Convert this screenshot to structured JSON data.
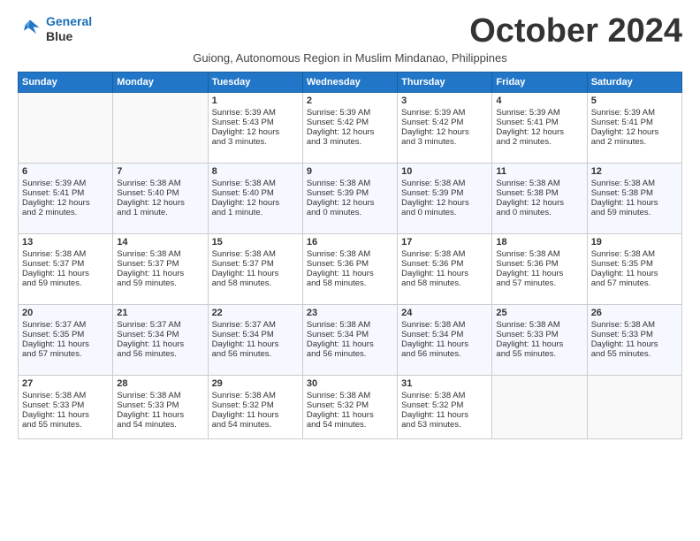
{
  "logo": {
    "line1": "General",
    "line2": "Blue"
  },
  "title": "October 2024",
  "subtitle": "Guiong, Autonomous Region in Muslim Mindanao, Philippines",
  "headers": [
    "Sunday",
    "Monday",
    "Tuesday",
    "Wednesday",
    "Thursday",
    "Friday",
    "Saturday"
  ],
  "weeks": [
    [
      {
        "day": "",
        "lines": []
      },
      {
        "day": "",
        "lines": []
      },
      {
        "day": "1",
        "lines": [
          "Sunrise: 5:39 AM",
          "Sunset: 5:43 PM",
          "Daylight: 12 hours",
          "and 3 minutes."
        ]
      },
      {
        "day": "2",
        "lines": [
          "Sunrise: 5:39 AM",
          "Sunset: 5:42 PM",
          "Daylight: 12 hours",
          "and 3 minutes."
        ]
      },
      {
        "day": "3",
        "lines": [
          "Sunrise: 5:39 AM",
          "Sunset: 5:42 PM",
          "Daylight: 12 hours",
          "and 3 minutes."
        ]
      },
      {
        "day": "4",
        "lines": [
          "Sunrise: 5:39 AM",
          "Sunset: 5:41 PM",
          "Daylight: 12 hours",
          "and 2 minutes."
        ]
      },
      {
        "day": "5",
        "lines": [
          "Sunrise: 5:39 AM",
          "Sunset: 5:41 PM",
          "Daylight: 12 hours",
          "and 2 minutes."
        ]
      }
    ],
    [
      {
        "day": "6",
        "lines": [
          "Sunrise: 5:39 AM",
          "Sunset: 5:41 PM",
          "Daylight: 12 hours",
          "and 2 minutes."
        ]
      },
      {
        "day": "7",
        "lines": [
          "Sunrise: 5:38 AM",
          "Sunset: 5:40 PM",
          "Daylight: 12 hours",
          "and 1 minute."
        ]
      },
      {
        "day": "8",
        "lines": [
          "Sunrise: 5:38 AM",
          "Sunset: 5:40 PM",
          "Daylight: 12 hours",
          "and 1 minute."
        ]
      },
      {
        "day": "9",
        "lines": [
          "Sunrise: 5:38 AM",
          "Sunset: 5:39 PM",
          "Daylight: 12 hours",
          "and 0 minutes."
        ]
      },
      {
        "day": "10",
        "lines": [
          "Sunrise: 5:38 AM",
          "Sunset: 5:39 PM",
          "Daylight: 12 hours",
          "and 0 minutes."
        ]
      },
      {
        "day": "11",
        "lines": [
          "Sunrise: 5:38 AM",
          "Sunset: 5:38 PM",
          "Daylight: 12 hours",
          "and 0 minutes."
        ]
      },
      {
        "day": "12",
        "lines": [
          "Sunrise: 5:38 AM",
          "Sunset: 5:38 PM",
          "Daylight: 11 hours",
          "and 59 minutes."
        ]
      }
    ],
    [
      {
        "day": "13",
        "lines": [
          "Sunrise: 5:38 AM",
          "Sunset: 5:37 PM",
          "Daylight: 11 hours",
          "and 59 minutes."
        ]
      },
      {
        "day": "14",
        "lines": [
          "Sunrise: 5:38 AM",
          "Sunset: 5:37 PM",
          "Daylight: 11 hours",
          "and 59 minutes."
        ]
      },
      {
        "day": "15",
        "lines": [
          "Sunrise: 5:38 AM",
          "Sunset: 5:37 PM",
          "Daylight: 11 hours",
          "and 58 minutes."
        ]
      },
      {
        "day": "16",
        "lines": [
          "Sunrise: 5:38 AM",
          "Sunset: 5:36 PM",
          "Daylight: 11 hours",
          "and 58 minutes."
        ]
      },
      {
        "day": "17",
        "lines": [
          "Sunrise: 5:38 AM",
          "Sunset: 5:36 PM",
          "Daylight: 11 hours",
          "and 58 minutes."
        ]
      },
      {
        "day": "18",
        "lines": [
          "Sunrise: 5:38 AM",
          "Sunset: 5:36 PM",
          "Daylight: 11 hours",
          "and 57 minutes."
        ]
      },
      {
        "day": "19",
        "lines": [
          "Sunrise: 5:38 AM",
          "Sunset: 5:35 PM",
          "Daylight: 11 hours",
          "and 57 minutes."
        ]
      }
    ],
    [
      {
        "day": "20",
        "lines": [
          "Sunrise: 5:37 AM",
          "Sunset: 5:35 PM",
          "Daylight: 11 hours",
          "and 57 minutes."
        ]
      },
      {
        "day": "21",
        "lines": [
          "Sunrise: 5:37 AM",
          "Sunset: 5:34 PM",
          "Daylight: 11 hours",
          "and 56 minutes."
        ]
      },
      {
        "day": "22",
        "lines": [
          "Sunrise: 5:37 AM",
          "Sunset: 5:34 PM",
          "Daylight: 11 hours",
          "and 56 minutes."
        ]
      },
      {
        "day": "23",
        "lines": [
          "Sunrise: 5:38 AM",
          "Sunset: 5:34 PM",
          "Daylight: 11 hours",
          "and 56 minutes."
        ]
      },
      {
        "day": "24",
        "lines": [
          "Sunrise: 5:38 AM",
          "Sunset: 5:34 PM",
          "Daylight: 11 hours",
          "and 56 minutes."
        ]
      },
      {
        "day": "25",
        "lines": [
          "Sunrise: 5:38 AM",
          "Sunset: 5:33 PM",
          "Daylight: 11 hours",
          "and 55 minutes."
        ]
      },
      {
        "day": "26",
        "lines": [
          "Sunrise: 5:38 AM",
          "Sunset: 5:33 PM",
          "Daylight: 11 hours",
          "and 55 minutes."
        ]
      }
    ],
    [
      {
        "day": "27",
        "lines": [
          "Sunrise: 5:38 AM",
          "Sunset: 5:33 PM",
          "Daylight: 11 hours",
          "and 55 minutes."
        ]
      },
      {
        "day": "28",
        "lines": [
          "Sunrise: 5:38 AM",
          "Sunset: 5:33 PM",
          "Daylight: 11 hours",
          "and 54 minutes."
        ]
      },
      {
        "day": "29",
        "lines": [
          "Sunrise: 5:38 AM",
          "Sunset: 5:32 PM",
          "Daylight: 11 hours",
          "and 54 minutes."
        ]
      },
      {
        "day": "30",
        "lines": [
          "Sunrise: 5:38 AM",
          "Sunset: 5:32 PM",
          "Daylight: 11 hours",
          "and 54 minutes."
        ]
      },
      {
        "day": "31",
        "lines": [
          "Sunrise: 5:38 AM",
          "Sunset: 5:32 PM",
          "Daylight: 11 hours",
          "and 53 minutes."
        ]
      },
      {
        "day": "",
        "lines": []
      },
      {
        "day": "",
        "lines": []
      }
    ]
  ]
}
